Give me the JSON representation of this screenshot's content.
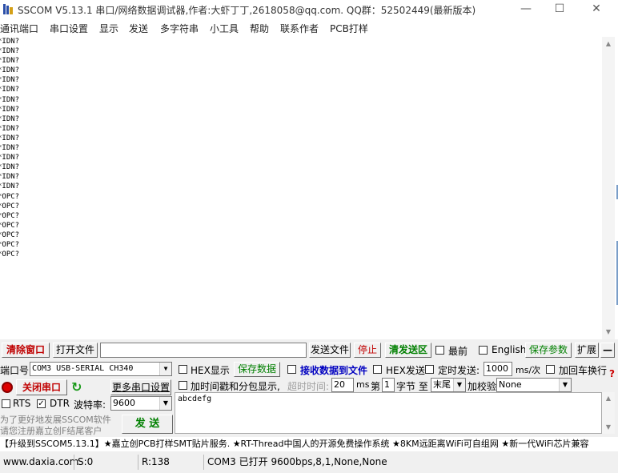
{
  "window": {
    "title": "SSCOM V5.13.1 串口/网络数据调试器,作者:大虾丁丁,2618058@qq.com. QQ群：52502449(最新版本)",
    "minimize_glyph": "—",
    "maximize_glyph": "☐",
    "close_glyph": "✕"
  },
  "menu": [
    "通讯端口",
    "串口设置",
    "显示",
    "发送",
    "多字符串",
    "小工具",
    "帮助",
    "联系作者",
    "PCB打样"
  ],
  "receive_lines": [
    "*IDN?",
    "*IDN?",
    "*IDN?",
    "*IDN?",
    "*IDN?",
    "*IDN?",
    "*IDN?",
    "*IDN?",
    "*IDN?",
    "*IDN?",
    "*IDN?",
    "*IDN?",
    "*IDN?",
    "*IDN?",
    "*IDN?",
    "*IDN?",
    "*OPC?",
    "*OPC?",
    "*OPC?",
    "*OPC?",
    "*OPC?",
    "*OPC?",
    "*OPC?"
  ],
  "toolbar1": {
    "clear_window": "清除窗口",
    "open_file": "打开文件",
    "file_path": "",
    "send_file": "发送文件",
    "stop": "停止",
    "clear_send": "清发送区",
    "topmost": "最前",
    "english": "English",
    "save_params": "保存参数",
    "expand": "扩展",
    "collapse": "—"
  },
  "port": {
    "port_label": "端口号",
    "port_value": "COM3 USB-SERIAL CH340",
    "close_port": "关闭串口",
    "more_settings": "更多串口设置",
    "rts": "RTS",
    "dtr": "DTR",
    "baud_label": "波特率:",
    "baud_value": "9600",
    "rts_checked": false,
    "dtr_checked": true
  },
  "options": {
    "hex_display": "HEX显示",
    "save_data": "保存数据",
    "receive_to_file": "接收数据到文件",
    "hex_send": "HEX发送",
    "timed_send": "定时发送:",
    "interval_value": "1000",
    "interval_unit": "ms/次",
    "add_crlf": "加回车换行",
    "add_timestamp": "加时间戳和分包显示,",
    "timeout_label": "超时时间:",
    "timeout_value": "20",
    "ms_unit": "ms",
    "byte_prefix": "第",
    "byte_value": "1",
    "byte_suffix": "字节 至",
    "end_value": "末尾",
    "checksum_label": "加校验",
    "checksum_value": "None",
    "question_mark": "?"
  },
  "send_text": "abcdefg",
  "send_button": "发 送",
  "promo_lines": [
    "为了更好地发展SSCOM软件",
    "请您注册嘉立创F结尾客户"
  ],
  "ticker": "【升级到SSCOM5.13.1】★嘉立创PCB打样SMT贴片服务. ★RT-Thread中国人的开源免费操作系统 ★8KM远距离WiFi可自组网 ★新一代WiFi芯片兼容",
  "status": {
    "website": "www.daxia.com",
    "sent": "S:0",
    "received": "R:138",
    "port_info": "COM3 已打开  9600bps,8,1,None,None"
  }
}
